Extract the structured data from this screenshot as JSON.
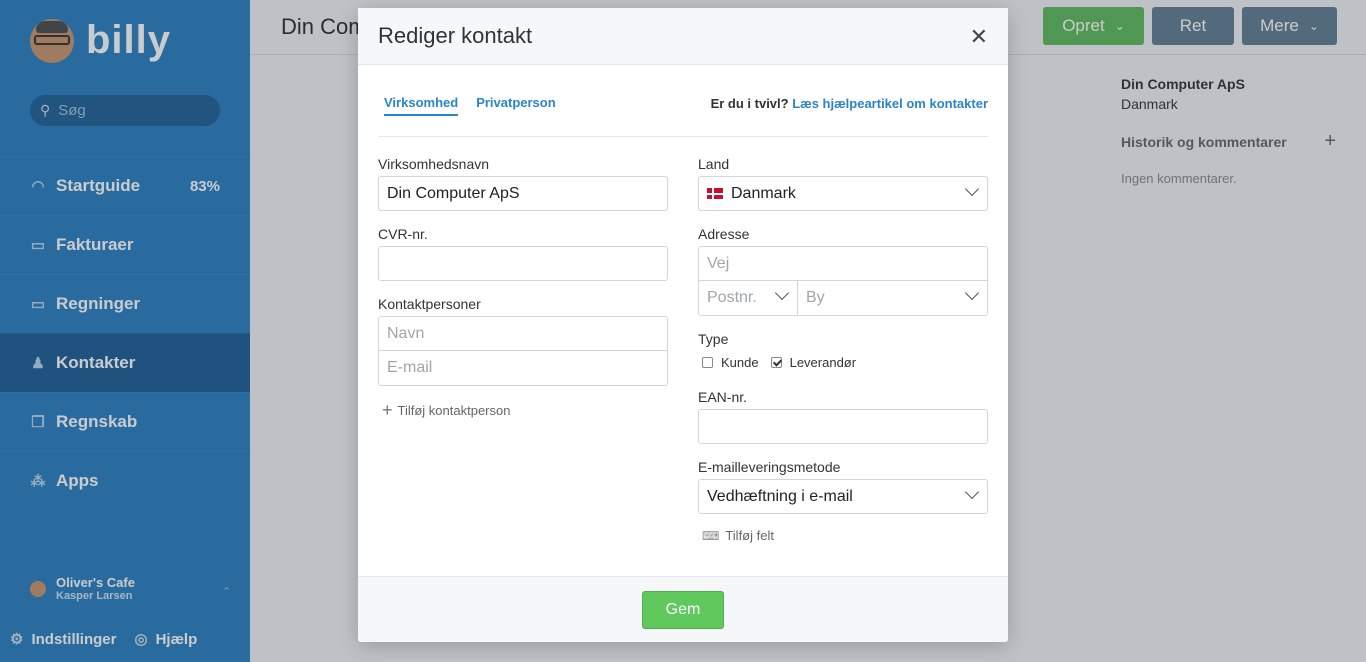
{
  "sidebar": {
    "logo_text": "billy",
    "search_placeholder": "Søg",
    "items": [
      {
        "label": "Startguide",
        "badge": "83%",
        "icon": "progress-icon"
      },
      {
        "label": "Fakturaer",
        "icon": "invoice-icon"
      },
      {
        "label": "Regninger",
        "icon": "bill-icon"
      },
      {
        "label": "Kontakter",
        "icon": "contact-icon"
      },
      {
        "label": "Regnskab",
        "icon": "accounting-icon"
      },
      {
        "label": "Apps",
        "icon": "apps-icon"
      }
    ],
    "org_name": "Oliver's Cafe",
    "org_user": "Kasper Larsen",
    "settings_label": "Indstillinger",
    "help_label": "Hjælp"
  },
  "page": {
    "title": "Din Com",
    "opret_label": "Opret",
    "ret_label": "Ret",
    "mere_label": "Mere",
    "contact_name": "Din Computer ApS",
    "contact_country": "Danmark",
    "history_label": "Historik og kommentarer",
    "no_comments": "Ingen kommentarer."
  },
  "modal": {
    "title": "Rediger kontakt",
    "tabs": [
      "Virksomhed",
      "Privatperson"
    ],
    "help_prefix": "Er du i tvivl?",
    "help_link": "Læs hjælpeartikel om kontakter",
    "company_name_label": "Virksomhedsnavn",
    "company_name_value": "Din Computer ApS",
    "cvr_label": "CVR-nr.",
    "cvr_value": "",
    "contacts_label": "Kontaktpersoner",
    "contact_name_placeholder": "Navn",
    "contact_email_placeholder": "E-mail",
    "add_contact_label": "Tilføj kontaktperson",
    "country_label": "Land",
    "country_value": "Danmark",
    "address_label": "Adresse",
    "street_placeholder": "Vej",
    "zip_placeholder": "Postnr.",
    "city_placeholder": "By",
    "type_label": "Type",
    "type_customer": "Kunde",
    "type_customer_checked": false,
    "type_supplier": "Leverandør",
    "type_supplier_checked": true,
    "ean_label": "EAN-nr.",
    "ean_value": "",
    "email_method_label": "E-mailleveringsmetode",
    "email_method_value": "Vedhæftning i e-mail",
    "add_field_label": "Tilføj felt",
    "save_label": "Gem"
  },
  "colors": {
    "sidebar_bg": "#2b7ec1",
    "accent": "#2b84c9",
    "save_green": "#5fc95d"
  }
}
